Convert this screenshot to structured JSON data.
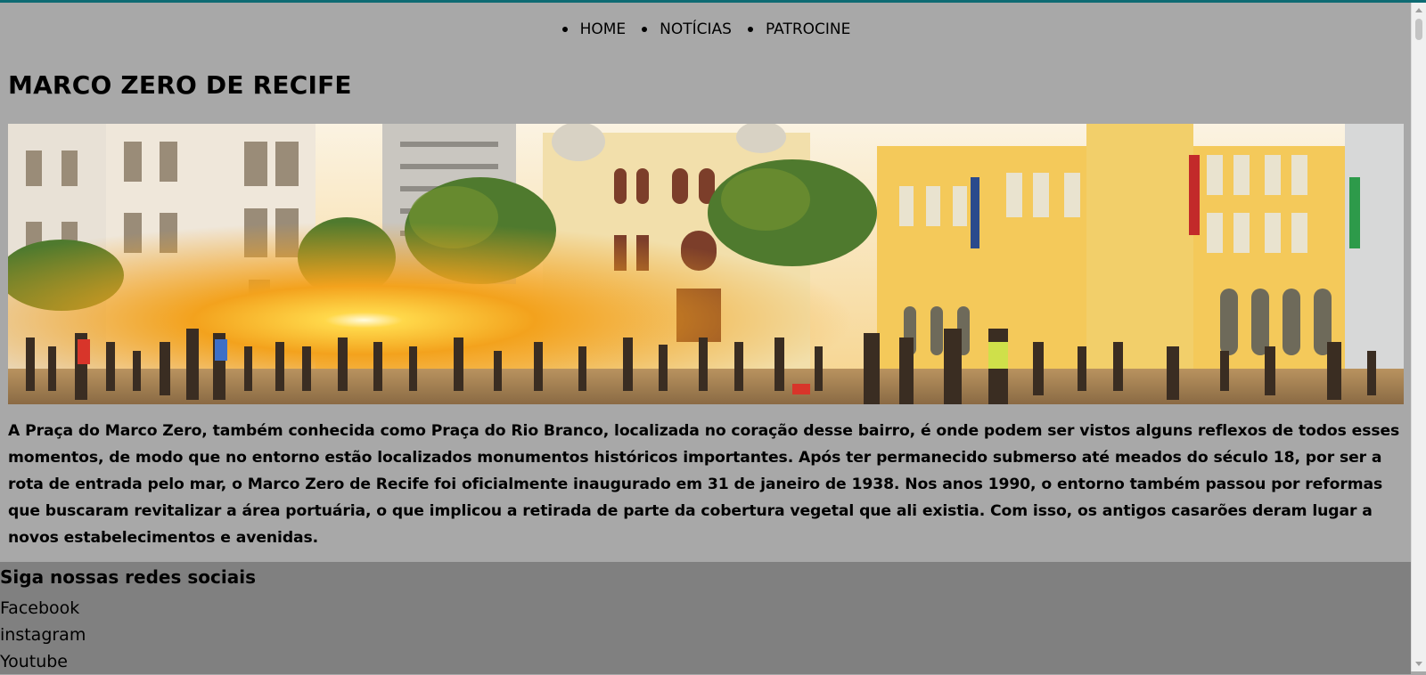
{
  "nav": {
    "items": [
      {
        "label": "HOME"
      },
      {
        "label": "NOTÍCIAS"
      },
      {
        "label": "PATROCINE"
      }
    ]
  },
  "main": {
    "title": "MARCO ZERO DE RECIFE",
    "hero_image": "Praça do Marco Zero, Recife",
    "paragraph": "A Praça do Marco Zero, também conhecida como Praça do Rio Branco, localizada no coração desse bairro, é onde podem ser vistos alguns reflexos de todos esses momentos, de modo que no entorno estão localizados monumentos históricos importantes. Após ter permanecido submerso até meados do século 18, por ser a rota de entrada pelo mar, o Marco Zero de Recife foi oficialmente inaugurado em 31 de janeiro de 1938. Nos anos 1990, o entorno também passou por reformas que buscaram revitalizar a área portuária, o que implicou a retirada de parte da cobertura vegetal que ali existia. Com isso, os antigos casarões deram lugar a novos estabelecimentos e avenidas."
  },
  "footer": {
    "heading": "Siga nossas redes sociais",
    "links": [
      {
        "label": "Facebook"
      },
      {
        "label": "instagram"
      },
      {
        "label": "Youtube"
      }
    ]
  },
  "colors": {
    "page_bg": "#a8a8a8",
    "footer_bg": "#808080",
    "top_accent": "#0e6b73"
  }
}
